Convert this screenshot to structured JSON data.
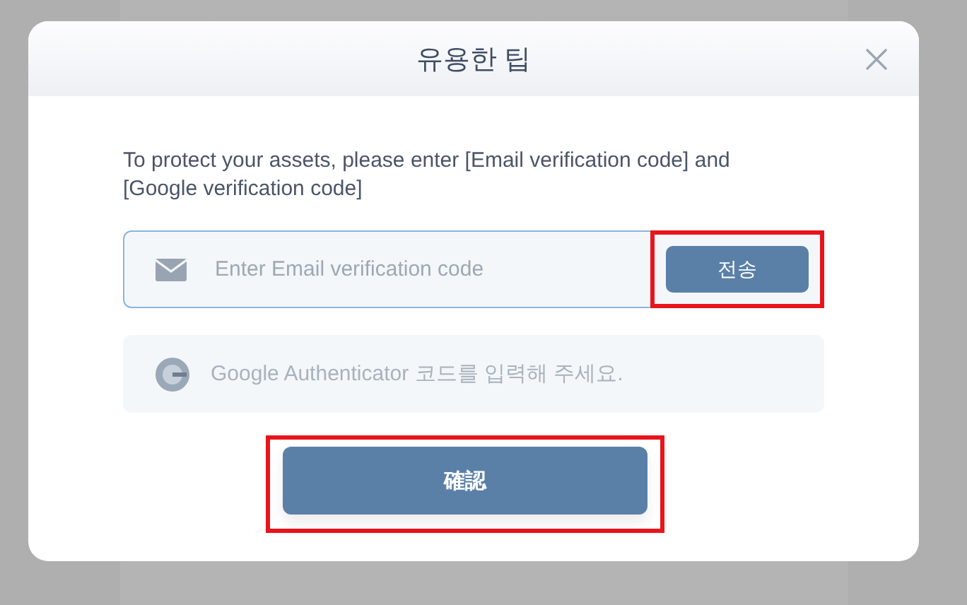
{
  "dialog": {
    "title": "유용한 팁",
    "message": "To protect your assets, please enter [Email verification code] and [Google verification code]",
    "email_field": {
      "placeholder": "Enter Email verification code"
    },
    "send_button": {
      "label": "전송",
      "highlighted": true
    },
    "google_field": {
      "placeholder": "Google Authenticator 코드를 입력해 주세요.",
      "disabled": true
    },
    "confirm_button": {
      "label": "確認",
      "highlighted": true
    }
  }
}
